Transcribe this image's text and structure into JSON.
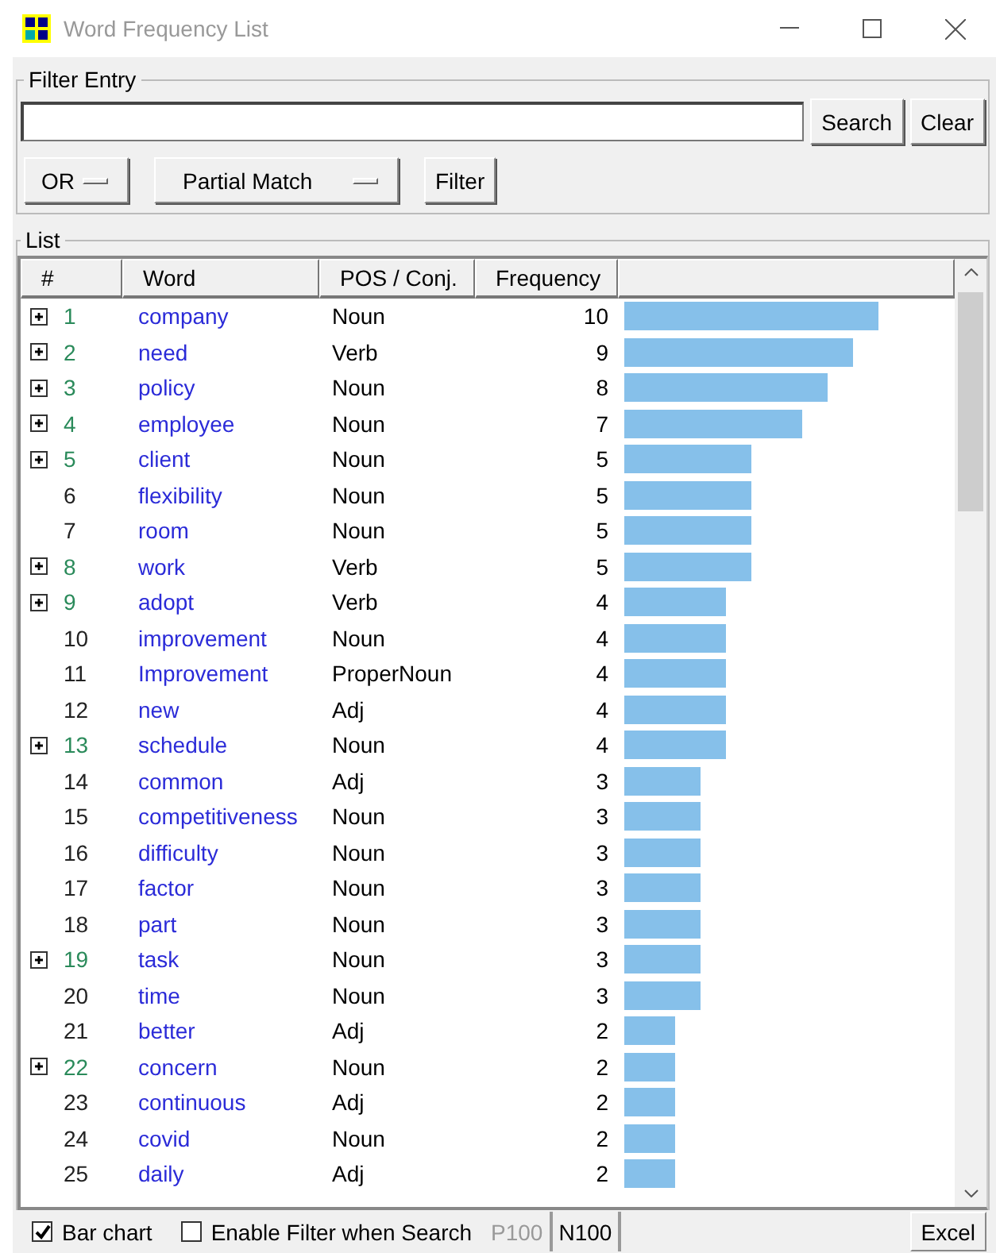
{
  "window": {
    "title": "Word Frequency List"
  },
  "filter_entry": {
    "title": "Filter Entry",
    "buttons": [
      "Search",
      "Clear"
    ],
    "logic_dropdown": "OR",
    "match_dropdown": "Partial Match",
    "filter_button": "Filter"
  },
  "list": {
    "title": "List",
    "columns": [
      "#",
      "Word",
      "POS / Conj.",
      "Frequency"
    ],
    "rows": [
      {
        "number": "1",
        "word": "company",
        "pos": "Noun",
        "frequency": "10",
        "expandable": true
      },
      {
        "number": "2",
        "word": "need",
        "pos": "Verb",
        "frequency": "9",
        "expandable": true
      },
      {
        "number": "3",
        "word": "policy",
        "pos": "Noun",
        "frequency": "8",
        "expandable": true
      },
      {
        "number": "4",
        "word": "employee",
        "pos": "Noun",
        "frequency": "7",
        "expandable": true
      },
      {
        "number": "5",
        "word": "client",
        "pos": "Noun",
        "frequency": "5",
        "expandable": true
      },
      {
        "number": "6",
        "word": "flexibility",
        "pos": "Noun",
        "frequency": "5",
        "expandable": false
      },
      {
        "number": "7",
        "word": "room",
        "pos": "Noun",
        "frequency": "5",
        "expandable": false
      },
      {
        "number": "8",
        "word": "work",
        "pos": "Verb",
        "frequency": "5",
        "expandable": true
      },
      {
        "number": "9",
        "word": "adopt",
        "pos": "Verb",
        "frequency": "4",
        "expandable": true
      },
      {
        "number": "10",
        "word": "improvement",
        "pos": "Noun",
        "frequency": "4",
        "expandable": false
      },
      {
        "number": "11",
        "word": "Improvement",
        "pos": "ProperNoun",
        "frequency": "4",
        "expandable": false
      },
      {
        "number": "12",
        "word": "new",
        "pos": "Adj",
        "frequency": "4",
        "expandable": false
      },
      {
        "number": "13",
        "word": "schedule",
        "pos": "Noun",
        "frequency": "4",
        "expandable": true
      },
      {
        "number": "14",
        "word": "common",
        "pos": "Adj",
        "frequency": "3",
        "expandable": false
      },
      {
        "number": "15",
        "word": "competitiveness",
        "pos": "Noun",
        "frequency": "3",
        "expandable": false
      },
      {
        "number": "16",
        "word": "difficulty",
        "pos": "Noun",
        "frequency": "3",
        "expandable": false
      },
      {
        "number": "17",
        "word": "factor",
        "pos": "Noun",
        "frequency": "3",
        "expandable": false
      },
      {
        "number": "18",
        "word": "part",
        "pos": "Noun",
        "frequency": "3",
        "expandable": false
      },
      {
        "number": "19",
        "word": "task",
        "pos": "Noun",
        "frequency": "3",
        "expandable": true
      },
      {
        "number": "20",
        "word": "time",
        "pos": "Noun",
        "frequency": "3",
        "expandable": false
      },
      {
        "number": "21",
        "word": "better",
        "pos": "Adj",
        "frequency": "2",
        "expandable": false
      },
      {
        "number": "22",
        "word": "concern",
        "pos": "Noun",
        "frequency": "2",
        "expandable": true
      },
      {
        "number": "23",
        "word": "continuous",
        "pos": "Adj",
        "frequency": "2",
        "expandable": false
      },
      {
        "number": "24",
        "word": "covid",
        "pos": "Noun",
        "frequency": "2",
        "expandable": false
      },
      {
        "number": "25",
        "word": "daily",
        "pos": "Adj",
        "frequency": "2",
        "expandable": false
      }
    ]
  },
  "footer": {
    "checkboxes": [
      {
        "label": "Bar chart",
        "checked": true
      },
      {
        "label": "Enable Filter when Search",
        "checked": false
      }
    ],
    "page_buttons": [
      {
        "label": "P100",
        "disabled": true
      },
      {
        "label": "N100",
        "disabled": false
      }
    ],
    "export_button": "Excel"
  }
}
